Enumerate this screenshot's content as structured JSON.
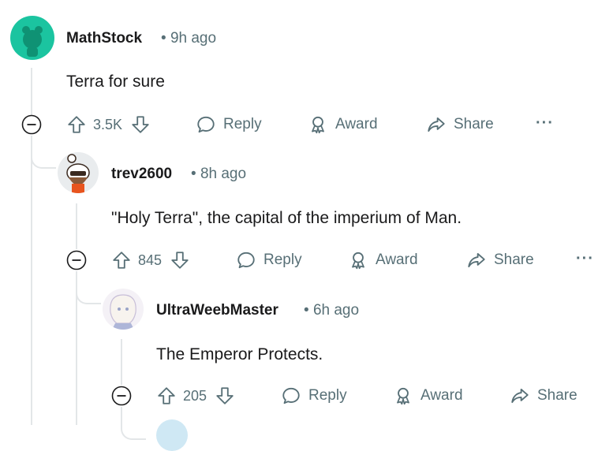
{
  "comments": [
    {
      "username": "MathStock",
      "time": "9h ago",
      "text": "Terra for sure",
      "votes": "3.5K",
      "reply": "Reply",
      "award": "Award",
      "share": "Share",
      "more": "···"
    },
    {
      "username": "trev2600",
      "time": "8h ago",
      "text": "\"Holy Terra\", the capital of the imperium of Man.",
      "votes": "845",
      "reply": "Reply",
      "award": "Award",
      "share": "Share",
      "more": "···"
    },
    {
      "username": "UltraWeebMaster",
      "time": "6h ago",
      "text": "The Emperor Protects.",
      "votes": "205",
      "reply": "Reply",
      "award": "Award",
      "share": "Share"
    }
  ],
  "colors": {
    "text": "#1a1a1b",
    "muted": "#576f76",
    "thread": "#e3e6e8",
    "avatar_green": "#1bc4a0"
  },
  "separator": "•"
}
